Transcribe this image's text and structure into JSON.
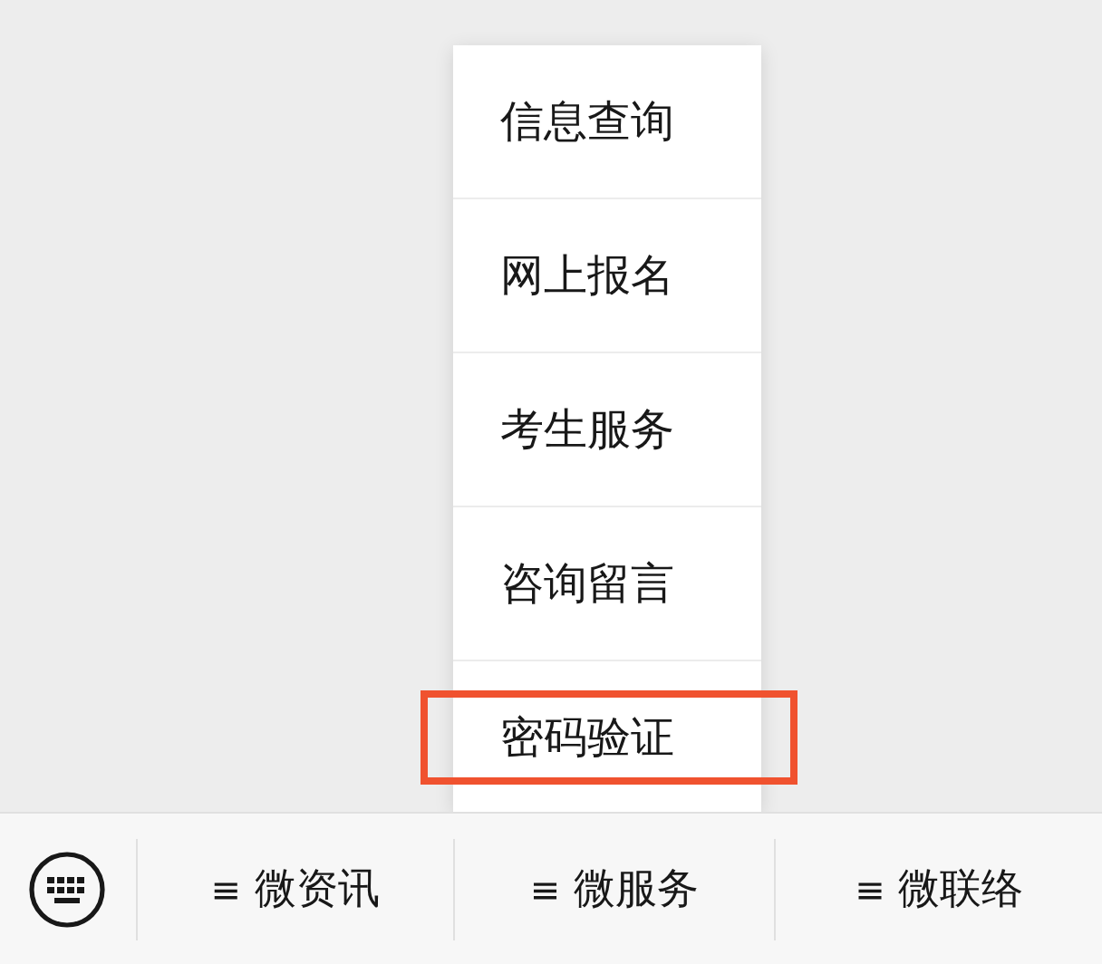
{
  "menu": {
    "items": [
      {
        "label": "信息查询",
        "annotated": false
      },
      {
        "label": "网上报名",
        "annotated": false
      },
      {
        "label": "考生服务",
        "annotated": false
      },
      {
        "label": "咨询留言",
        "annotated": false
      },
      {
        "label": "密码验证",
        "annotated": true
      }
    ]
  },
  "bottom_bar": {
    "menus": [
      {
        "icon": "≡",
        "label": "微资讯"
      },
      {
        "icon": "≡",
        "label": "微服务"
      },
      {
        "icon": "≡",
        "label": "微联络"
      }
    ]
  }
}
